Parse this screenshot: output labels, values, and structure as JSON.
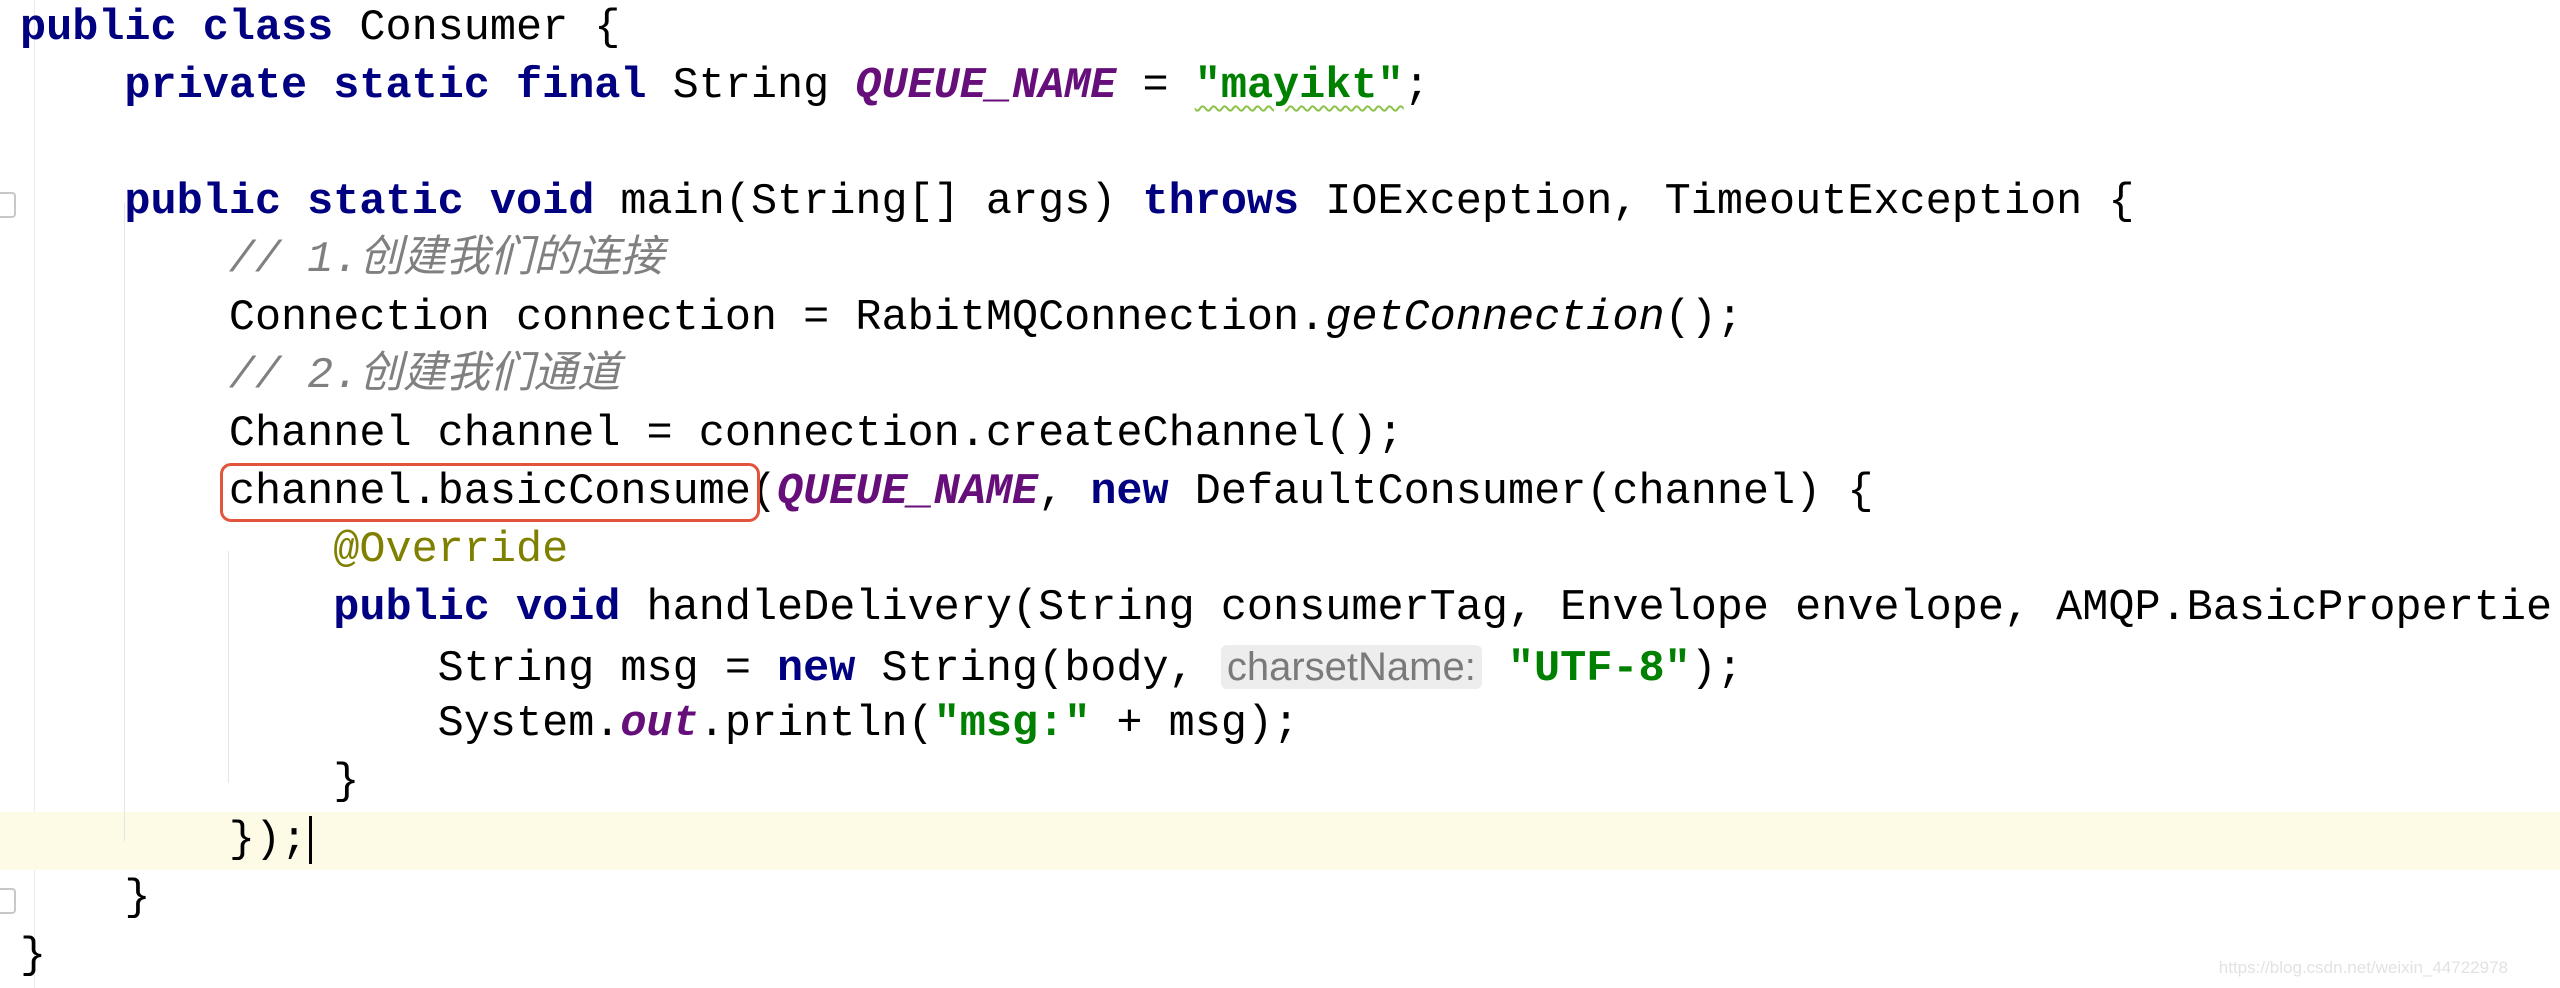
{
  "editor": {
    "colors": {
      "keyword": "#000080",
      "string": "#008000",
      "field": "#660e7a",
      "comment": "#808080",
      "annotation": "#808000",
      "highlight_box": "#e2553c",
      "current_line": "#fdfbe6"
    },
    "current_line_index": 14,
    "lines": [
      {
        "indent": 0,
        "tokens": [
          {
            "c": "kw",
            "t": "public class"
          },
          {
            "c": "",
            "t": " Consumer {"
          }
        ]
      },
      {
        "indent": 1,
        "tokens": [
          {
            "c": "kw",
            "t": "private static final"
          },
          {
            "c": "",
            "t": " String "
          },
          {
            "c": "field",
            "t": "QUEUE_NAME"
          },
          {
            "c": "",
            "t": " = "
          },
          {
            "c": "str squiggle",
            "t": "\"mayikt\""
          },
          {
            "c": "",
            "t": ";"
          }
        ]
      },
      {
        "indent": 0,
        "tokens": []
      },
      {
        "indent": 1,
        "tokens": [
          {
            "c": "kw",
            "t": "public static void"
          },
          {
            "c": "",
            "t": " main(String[] args) "
          },
          {
            "c": "kw",
            "t": "throws"
          },
          {
            "c": "",
            "t": " IOException, TimeoutException {"
          }
        ]
      },
      {
        "indent": 2,
        "tokens": [
          {
            "c": "cm",
            "t": "// 1.创建我们的连接"
          }
        ]
      },
      {
        "indent": 2,
        "tokens": [
          {
            "c": "",
            "t": "Connection connection = RabitMQConnection."
          },
          {
            "c": "static-m",
            "t": "getConnection"
          },
          {
            "c": "",
            "t": "();"
          }
        ]
      },
      {
        "indent": 2,
        "tokens": [
          {
            "c": "cm",
            "t": "// 2.创建我们通道"
          }
        ]
      },
      {
        "indent": 2,
        "tokens": [
          {
            "c": "",
            "t": "Channel channel = connection.createChannel();"
          }
        ]
      },
      {
        "indent": 2,
        "tokens": [
          {
            "c": "boxed",
            "t": "channel.basicConsume"
          },
          {
            "c": "",
            "t": "("
          },
          {
            "c": "field",
            "t": "QUEUE_NAME"
          },
          {
            "c": "",
            "t": ", "
          },
          {
            "c": "kw",
            "t": "new"
          },
          {
            "c": "",
            "t": " DefaultConsumer(channel) {"
          }
        ]
      },
      {
        "indent": 3,
        "tokens": [
          {
            "c": "ann",
            "t": "@Override"
          }
        ]
      },
      {
        "indent": 3,
        "tokens": [
          {
            "c": "kw",
            "t": "public void"
          },
          {
            "c": "",
            "t": " handleDelivery(String consumerTag, Envelope envelope, AMQP.BasicPropertie"
          }
        ]
      },
      {
        "indent": 4,
        "tokens": [
          {
            "c": "",
            "t": "String msg = "
          },
          {
            "c": "kw",
            "t": "new"
          },
          {
            "c": "",
            "t": " String(body, "
          },
          {
            "c": "hint",
            "t": "charsetName:"
          },
          {
            "c": "",
            "t": " "
          },
          {
            "c": "str",
            "t": "\"UTF-8\""
          },
          {
            "c": "",
            "t": ");"
          }
        ]
      },
      {
        "indent": 4,
        "tokens": [
          {
            "c": "",
            "t": "System."
          },
          {
            "c": "field",
            "t": "out"
          },
          {
            "c": "",
            "t": ".println("
          },
          {
            "c": "str",
            "t": "\"msg:\""
          },
          {
            "c": "",
            "t": " + msg);"
          }
        ]
      },
      {
        "indent": 3,
        "tokens": [
          {
            "c": "",
            "t": "}"
          }
        ]
      },
      {
        "indent": 2,
        "tokens": [
          {
            "c": "",
            "t": "});"
          }
        ],
        "caret": true
      },
      {
        "indent": 1,
        "tokens": [
          {
            "c": "",
            "t": "}"
          }
        ]
      },
      {
        "indent": 0,
        "tokens": [
          {
            "c": "",
            "t": "}"
          }
        ]
      }
    ]
  },
  "watermark": "https://blog.csdn.net/weixin_44722978"
}
